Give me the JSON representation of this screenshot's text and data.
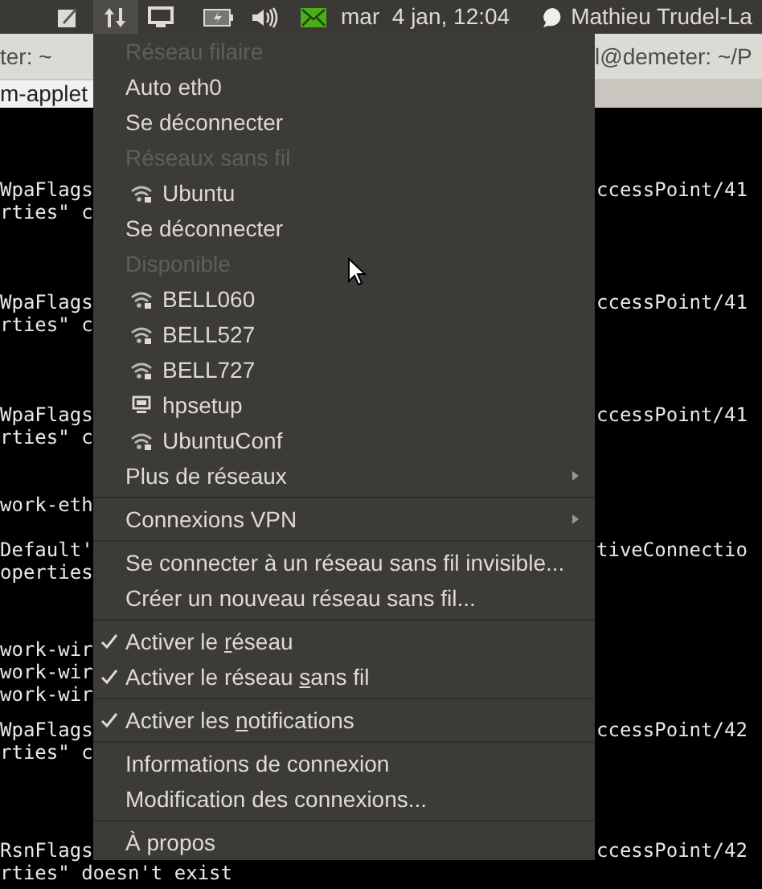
{
  "top_panel": {
    "clock": "mar  4 jan, 12:04",
    "user": "Mathieu Trudel-La"
  },
  "left_window": {
    "title": "ter: ~",
    "tab": "m-applet",
    "blocks": [
      [
        "WpaFlags",
        "rties\" c"
      ],
      [
        "WpaFlags",
        "rties\" c"
      ],
      [
        "WpaFlags",
        "rties\" c"
      ],
      [
        "work-eth"
      ],
      [
        "Default'",
        "operties"
      ],
      [
        "work-wir",
        "work-wir",
        "work-wir"
      ],
      [
        "WpaFlags",
        "rties\" c"
      ],
      [
        "RsnFlags",
        "rties\" doesn't exist"
      ]
    ]
  },
  "right_window": {
    "title": "l@demeter: ~/P",
    "blocks": [
      [
        "ccessPoint/41"
      ],
      [
        "ccessPoint/41"
      ],
      [
        "ccessPoint/41"
      ],
      [
        "tiveConnectio"
      ],
      [
        "ccessPoint/42"
      ],
      [
        "ccessPoint/42"
      ]
    ]
  },
  "menu": {
    "items": [
      {
        "kind": "header",
        "label": "Réseau filaire"
      },
      {
        "kind": "action",
        "label": "Auto eth0"
      },
      {
        "kind": "action",
        "label": "Se déconnecter"
      },
      {
        "kind": "header",
        "label": "Réseaux sans fil"
      },
      {
        "kind": "wifi",
        "label": "Ubuntu"
      },
      {
        "kind": "action",
        "label": "Se déconnecter"
      },
      {
        "kind": "header",
        "label": "Disponible"
      },
      {
        "kind": "wifi",
        "label": "BELL060"
      },
      {
        "kind": "wifi",
        "label": "BELL527"
      },
      {
        "kind": "wifi",
        "label": "BELL727"
      },
      {
        "kind": "wired",
        "label": "hpsetup"
      },
      {
        "kind": "wifi",
        "label": "UbuntuConf"
      },
      {
        "kind": "submenu",
        "label": "Plus de réseaux"
      },
      {
        "kind": "separator"
      },
      {
        "kind": "submenu",
        "label": "Connexions VPN"
      },
      {
        "kind": "separator"
      },
      {
        "kind": "action",
        "label": "Se connecter à un réseau sans fil invisible..."
      },
      {
        "kind": "action",
        "label": "Créer un nouveau réseau sans fil..."
      },
      {
        "kind": "separator"
      },
      {
        "kind": "check",
        "checked": true,
        "label_parts": [
          "Activer le ",
          "r",
          "éseau"
        ]
      },
      {
        "kind": "check",
        "checked": true,
        "label_parts": [
          "Activer le réseau ",
          "s",
          "ans fil"
        ]
      },
      {
        "kind": "separator"
      },
      {
        "kind": "check",
        "checked": true,
        "label_parts": [
          "Activer les ",
          "n",
          "otifications"
        ]
      },
      {
        "kind": "separator"
      },
      {
        "kind": "action",
        "label": "Informations de connexion"
      },
      {
        "kind": "action",
        "label": "Modification des connexions..."
      },
      {
        "kind": "separator"
      },
      {
        "kind": "action",
        "label": "À propos"
      }
    ]
  }
}
